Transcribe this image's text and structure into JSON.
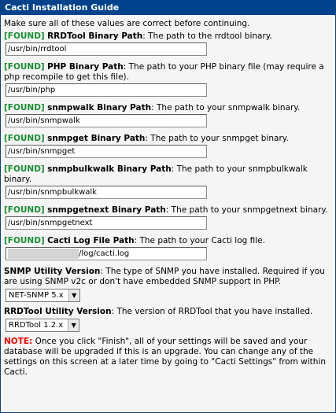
{
  "window": {
    "title": "Cacti Installation Guide"
  },
  "intro": "Make sure all of these values are correct before continuing.",
  "found_tag": "[FOUND]",
  "fields": [
    {
      "label": "RRDTool Binary Path",
      "desc": ": The path to the rrdtool binary.",
      "value": "/usr/bin/rrdtool"
    },
    {
      "label": "PHP Binary Path",
      "desc": ": The path to your PHP binary file (may require a php recompile to get this file).",
      "value": "/usr/bin/php"
    },
    {
      "label": "snmpwalk Binary Path",
      "desc": ": The path to your snmpwalk binary.",
      "value": "/usr/bin/snmpwalk"
    },
    {
      "label": "snmpget Binary Path",
      "desc": ": The path to your snmpget binary.",
      "value": "/usr/bin/snmpget"
    },
    {
      "label": "snmpbulkwalk Binary Path",
      "desc": ": The path to your snmpbulkwalk binary.",
      "value": "/usr/bin/snmpbulkwalk"
    },
    {
      "label": "snmpgetnext Binary Path",
      "desc": ": The path to your snmpgetnext binary.",
      "value": "/usr/bin/snmpgetnext"
    },
    {
      "label": "Cacti Log File Path",
      "desc": ": The path to your Cacti log file.",
      "value": "/log/cacti.log"
    }
  ],
  "snmp_version": {
    "label": "SNMP Utility Version",
    "desc": ": The type of SNMP you have installed. Required if you are using SNMP v2c or don't have embedded SNMP support in PHP.",
    "selected": "NET-SNMP 5.x"
  },
  "rrdtool_version": {
    "label": "RRDTool Utility Version",
    "desc": ": The version of RRDTool that you have installed.",
    "selected": "RRDTool 1.2.x"
  },
  "note": {
    "label": "NOTE:",
    "text": " Once you click \"Finish\", all of your settings will be saved and your database will be upgraded if this is an upgrade. You can change any of the settings on this screen at a later time by going to \"Cacti Settings\" from within Cacti."
  },
  "colors": {
    "title_bar": "#00438c",
    "found": "#198e32",
    "note": "#ff0000"
  }
}
